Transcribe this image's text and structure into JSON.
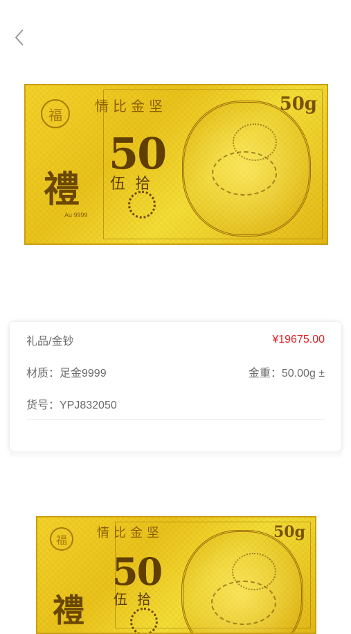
{
  "nav": {
    "back_icon": "chevron-left-icon"
  },
  "product_image": {
    "weight_mark": "50g",
    "title_text": "情比金坚",
    "denomination": "50",
    "denomination_cn": "伍拾",
    "li_char": "禮",
    "fu_char": "福",
    "purity": "Au 9999"
  },
  "info": {
    "category": "礼品/金钞",
    "price": "¥19675.00",
    "material": "材质：足金9999",
    "weight": "金重：50.00g ±",
    "sku": "货号：YPJ832050"
  },
  "colors": {
    "price": "#e02020",
    "gold": "#f0cf27"
  }
}
